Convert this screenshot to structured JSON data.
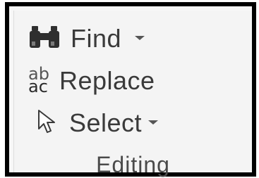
{
  "group": {
    "label": "Editing"
  },
  "commands": {
    "find": {
      "label": "Find",
      "icon": "binoculars-icon",
      "has_dropdown": true
    },
    "replace": {
      "label": "Replace",
      "icon": "replace-ab-ac-icon",
      "icon_text_top": "ab",
      "icon_text_bottom": "ac"
    },
    "select": {
      "label": "Select",
      "icon": "cursor-arrow-icon",
      "has_dropdown": true
    }
  },
  "colors": {
    "border": "#000000",
    "background": "#f4f4f4",
    "text": "#3a3a3a",
    "binoculars": "#2f2f2f"
  }
}
